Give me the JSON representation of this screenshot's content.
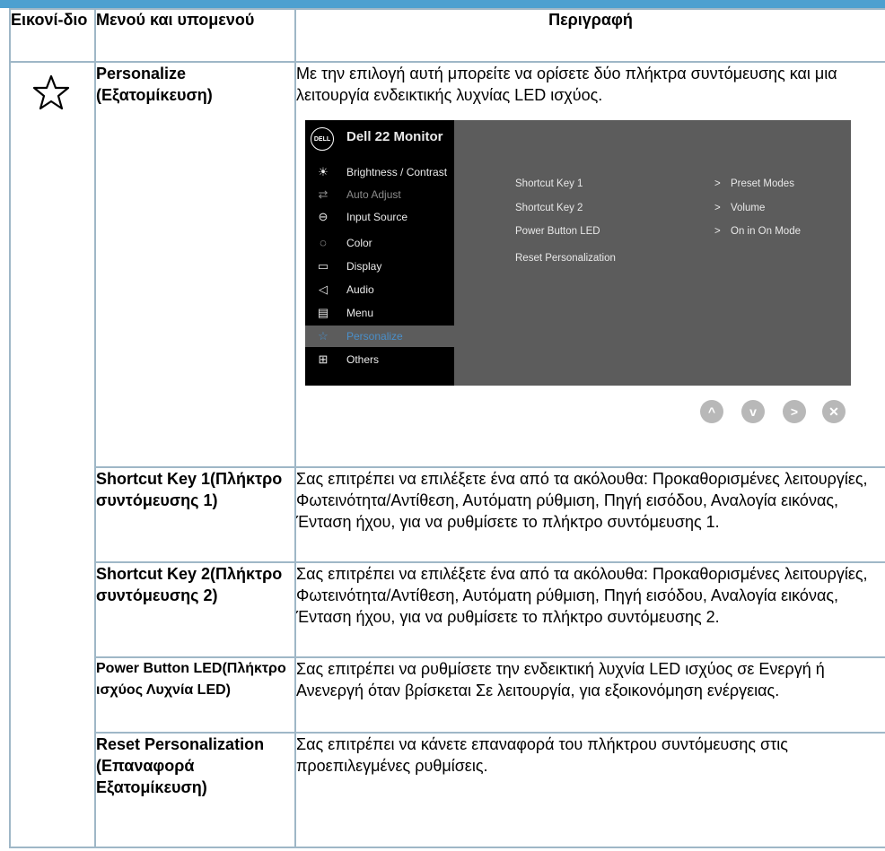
{
  "header": {
    "col1": "Εικονί-διο",
    "col2": "Μενού και υπομενού",
    "col3": "Περιγραφή"
  },
  "rows": [
    {
      "menu": "Personalize (Εξατομίκευση)",
      "desc": "Με την επιλογή αυτή μπορείτε να ορίσετε δύο πλήκτρα συντόμευσης και μια λειτουργία ενδεικτικής λυχνίας LED ισχύος."
    },
    {
      "menu": "Shortcut Key 1(Πλήκτρο συντόμευσης 1)",
      "desc": "Σας επιτρέπει να επιλέξετε ένα από τα ακόλουθα: Προκαθορισμένες λειτουργίες, Φωτεινότητα/Αντίθεση, Αυτόματη ρύθμιση, Πηγή εισόδου, Αναλογία εικόνας, Ένταση ήχου, για να ρυθμίσετε το πλήκτρο συντόμευσης 1."
    },
    {
      "menu": "Shortcut Key 2(Πλήκτρο συντόμευσης 2)",
      "desc": "Σας επιτρέπει να επιλέξετε ένα από τα ακόλουθα: Προκαθορισμένες λειτουργίες, Φωτεινότητα/Αντίθεση, Αυτόματη ρύθμιση, Πηγή εισόδου, Αναλογία εικόνας, Ένταση ήχου, για να ρυθμίσετε το πλήκτρο συντόμευσης 2."
    },
    {
      "menu": "Power Button LED(Πλήκτρο ισχύος Λυχνία LED)",
      "desc": "Σας επιτρέπει να ρυθμίσετε την ενδεικτική λυχνία LED ισχύος σε Ενεργή ή Ανενεργή όταν βρίσκεται Σε λειτουργία, για εξοικονόμηση ενέργειας."
    },
    {
      "menu": "Reset Personalization (Επαναφορά Εξατομίκευση)",
      "desc": "Σας επιτρέπει να κάνετε επαναφορά του πλήκτρου συντόμευσης στις προεπιλεγμένες ρυθμίσεις."
    }
  ],
  "osd": {
    "logo": "DELL",
    "title": "Dell 22 Monitor",
    "menu": [
      {
        "icon": "brightness-icon",
        "glyph": "☀",
        "label": "Brightness / Contrast"
      },
      {
        "icon": "auto-adjust-icon",
        "glyph": "⇄",
        "label": "Auto Adjust"
      },
      {
        "icon": "input-source-icon",
        "glyph": "⊖",
        "label": "Input Source"
      },
      {
        "icon": "color-icon",
        "glyph": "◌",
        "label": "Color"
      },
      {
        "icon": "display-icon",
        "glyph": "▭",
        "label": "Display"
      },
      {
        "icon": "audio-icon",
        "glyph": "◁",
        "label": "Audio"
      },
      {
        "icon": "menu-icon",
        "glyph": "▤",
        "label": "Menu"
      },
      {
        "icon": "star-icon",
        "glyph": "☆",
        "label": "Personalize"
      },
      {
        "icon": "others-icon",
        "glyph": "⊞",
        "label": "Others"
      }
    ],
    "settings": [
      {
        "label": "Shortcut Key 1",
        "value": "Preset Modes"
      },
      {
        "label": "Shortcut Key 2",
        "value": "Volume"
      },
      {
        "label": "Power Button LED",
        "value": "On in On Mode"
      },
      {
        "label": "Reset Personalization",
        "value": ""
      }
    ],
    "arrow": ">",
    "buttons": [
      {
        "icon": "up-arrow-icon",
        "glyph": "^"
      },
      {
        "icon": "down-arrow-icon",
        "glyph": "v"
      },
      {
        "icon": "right-arrow-icon",
        "glyph": ">"
      },
      {
        "icon": "close-icon",
        "glyph": "✕"
      }
    ],
    "accent": "#4a8fc9"
  }
}
